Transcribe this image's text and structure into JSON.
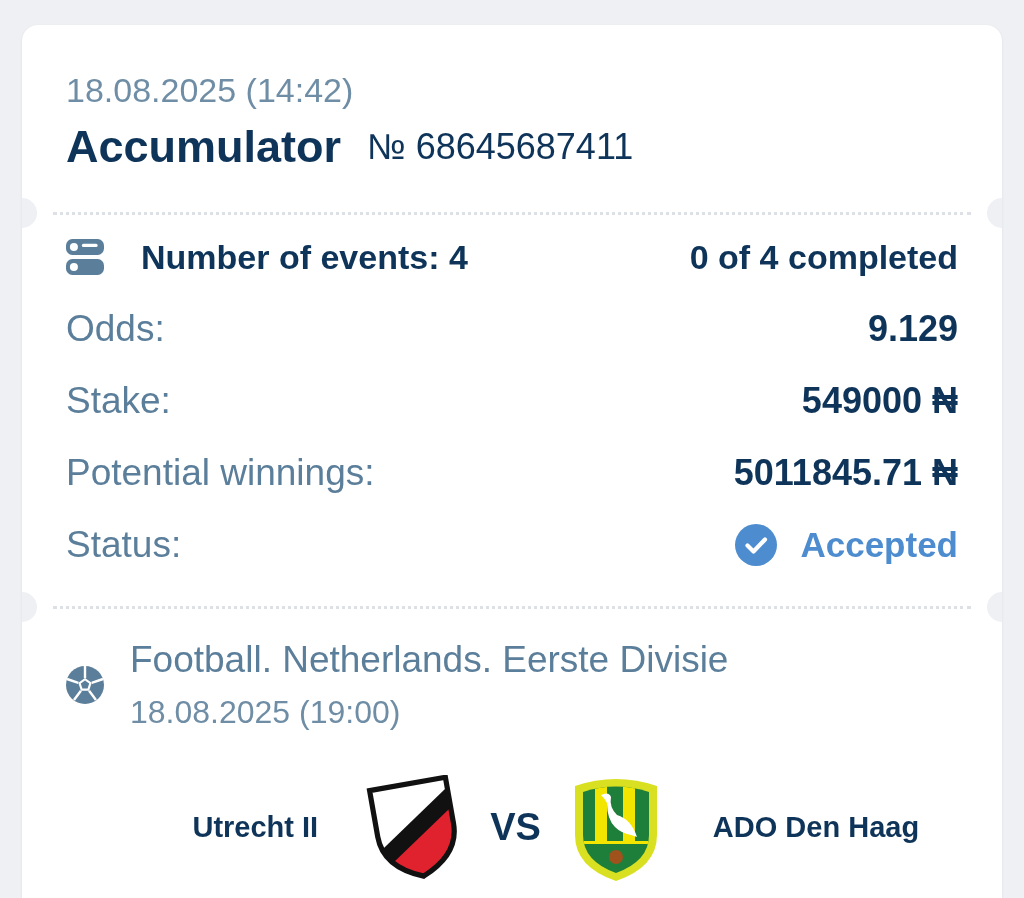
{
  "bet": {
    "date": "18.08.2025 (14:42)",
    "type": "Accumulator",
    "number": "№ 68645687411"
  },
  "summary": {
    "events": "Number of events: 4",
    "completed": "0 of 4 completed"
  },
  "details": [
    {
      "label": "Odds:",
      "value": "9.129"
    },
    {
      "label": "Stake:",
      "value": "549000 ₦"
    },
    {
      "label": "Potential winnings:",
      "value": "5011845.71 ₦"
    }
  ],
  "status": {
    "label": "Status:",
    "value": "Accepted",
    "kind": "accepted"
  },
  "events": [
    {
      "kind": "football",
      "league": "Football. Netherlands. Eerste Divisie",
      "date": "18.08.2025 (19:00)",
      "home": {
        "name": "Utrecht II"
      },
      "vs": "VS",
      "away": {
        "name": "ADO Den Haag"
      }
    }
  ]
}
